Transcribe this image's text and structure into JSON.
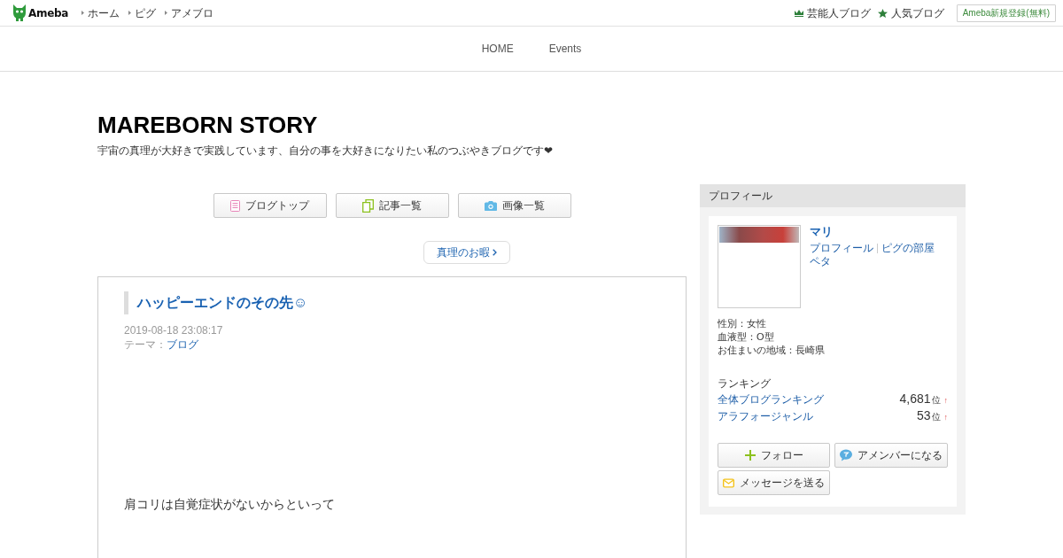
{
  "global_header": {
    "logo": "Ameba",
    "links": [
      "ホーム",
      "ピグ",
      "アメブロ"
    ],
    "right_links": [
      {
        "kind": "crown",
        "label": "芸能人ブログ"
      },
      {
        "kind": "star",
        "label": "人気ブログ"
      }
    ],
    "signup_button": "Ameba新規登録(無料)"
  },
  "blog_nav": [
    "HOME",
    "Events"
  ],
  "blog_header": {
    "title": "MAREBORN STORY",
    "description": "宇宙の真理が大好きで実践しています、自分の事を大好きになりたい私のつぶやきブログです❤"
  },
  "blog_menu": [
    {
      "kind": "top",
      "label": "ブログトップ"
    },
    {
      "kind": "entries",
      "label": "記事一覧"
    },
    {
      "kind": "images",
      "label": "画像一覧"
    }
  ],
  "pager": {
    "next": "真理のお暇"
  },
  "article": {
    "title": "ハッピーエンドのその先☺",
    "date": "2019-08-18 23:08:17",
    "theme_label": "テーマ：",
    "theme": "ブログ",
    "paragraphs": [
      "肩コリは自覚症状がないからといって"
    ]
  },
  "profile": {
    "heading": "プロフィール",
    "name": "マリ",
    "links": [
      "プロフィール",
      "ピグの部屋",
      "ペタ"
    ],
    "details": [
      "性別：女性",
      "血液型：O型",
      "お住まいの地域：長崎県"
    ],
    "ranking_heading": "ランキング",
    "rankings": [
      {
        "label": "全体ブログランキング",
        "rank": "4,681",
        "unit": "位",
        "trend": "↑"
      },
      {
        "label": "アラフォージャンル",
        "rank": "53",
        "unit": "位",
        "trend": "↑"
      }
    ],
    "buttons": [
      {
        "kind": "follow",
        "label": "フォロー"
      },
      {
        "kind": "amember",
        "label": "アメンバーになる"
      },
      {
        "kind": "message",
        "label": "メッセージを送る"
      }
    ]
  }
}
